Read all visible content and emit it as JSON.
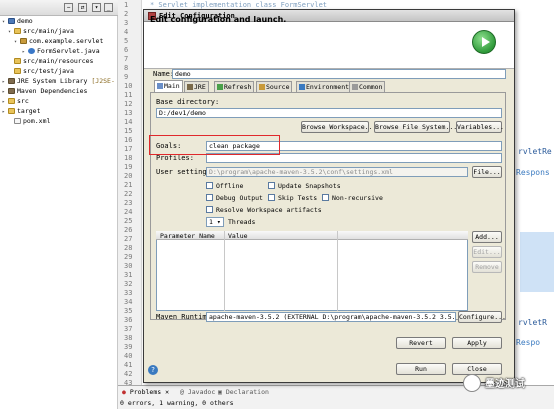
{
  "explorer": {
    "items": [
      {
        "label": "demo",
        "type": "project",
        "depth": 0
      },
      {
        "label": "src/main/java",
        "type": "folder",
        "depth": 1
      },
      {
        "label": "com.example.servlet",
        "type": "package",
        "depth": 2
      },
      {
        "label": "FormServlet.java",
        "type": "java",
        "depth": 3
      },
      {
        "label": "src/main/resources",
        "type": "folder",
        "depth": 1
      },
      {
        "label": "src/test/java",
        "type": "folder",
        "depth": 1
      },
      {
        "label": "JRE System Library",
        "suffix": "[J2SE-",
        "type": "library",
        "depth": 1
      },
      {
        "label": "Maven Dependencies",
        "type": "library",
        "depth": 1
      },
      {
        "label": "src",
        "type": "folder",
        "depth": 1
      },
      {
        "label": "target",
        "type": "folder",
        "depth": 1
      },
      {
        "label": "pom.xml",
        "type": "xml",
        "depth": 1
      }
    ]
  },
  "editor": {
    "top_line": "* Servlet implementation class FormServlet",
    "line_numbers": [
      "1",
      "2",
      "3",
      "4",
      "5",
      "6",
      "7",
      "8",
      "9",
      "10",
      "11",
      "12",
      "13",
      "14",
      "15",
      "16",
      "17",
      "18",
      "19",
      "20",
      "21",
      "22",
      "23",
      "24",
      "25",
      "26",
      "27",
      "28",
      "29",
      "30",
      "31",
      "32",
      "33",
      "34",
      "35",
      "36",
      "37",
      "38",
      "39",
      "40",
      "41",
      "42",
      "43"
    ],
    "fragment_1": "rvletRe",
    "fragment_2": "Respons",
    "fragment_3": "rvletR",
    "fragment_4": "Respo"
  },
  "dialog": {
    "title": "Edit Configuration",
    "header": "Edit configuration and launch.",
    "name_label": "Name:",
    "name_value": "demo",
    "tabs": [
      "Main",
      "JRE",
      "Refresh",
      "Source",
      "Environment",
      "Common"
    ],
    "base_dir_label": "Base directory:",
    "base_dir_value": "D:/dev1/demo",
    "browse_workspace": "Browse Workspace...",
    "browse_fs": "Browse File System...",
    "variables": "Variables...",
    "goals_label": "Goals:",
    "goals_value": "clean package",
    "profiles_label": "Profiles:",
    "profiles_value": "",
    "user_settings_label": "User settings:",
    "user_settings_value": "D:\\program\\apache-maven-3.5.2\\conf\\settings.xml",
    "file_button": "File...",
    "checkboxes": {
      "offline": "Offline",
      "update_snapshots": "Update Snapshots",
      "debug_output": "Debug Output",
      "skip_tests": "Skip Tests",
      "non_recursive": "Non-recursive",
      "resolve_workspace": "Resolve Workspace artifacts"
    },
    "threads_value": "1",
    "threads_label": "Threads",
    "table_headers": [
      "Parameter Name",
      "Value"
    ],
    "add_button": "Add...",
    "edit_button": "Edit...",
    "remove_button": "Remove",
    "runtime_label": "Maven Runtime:",
    "runtime_value": "apache-maven-3.5.2 (EXTERNAL D:\\program\\apache-maven-3.5.2 3.5.2)",
    "configure_button": "Configure...",
    "revert_button": "Revert",
    "apply_button": "Apply",
    "run_button": "Run",
    "close_button": "Close"
  },
  "problems": {
    "tabs": [
      "Problems",
      "Javadoc",
      "Declaration"
    ],
    "status": "0 errors, 1 warning, 0 others"
  },
  "watermark": {
    "text": "墨迹测试"
  },
  "colors": {
    "highlight_border": "#e0292c",
    "dialog_bg": "#ece9d8",
    "run_green": "#2f9a3a"
  }
}
